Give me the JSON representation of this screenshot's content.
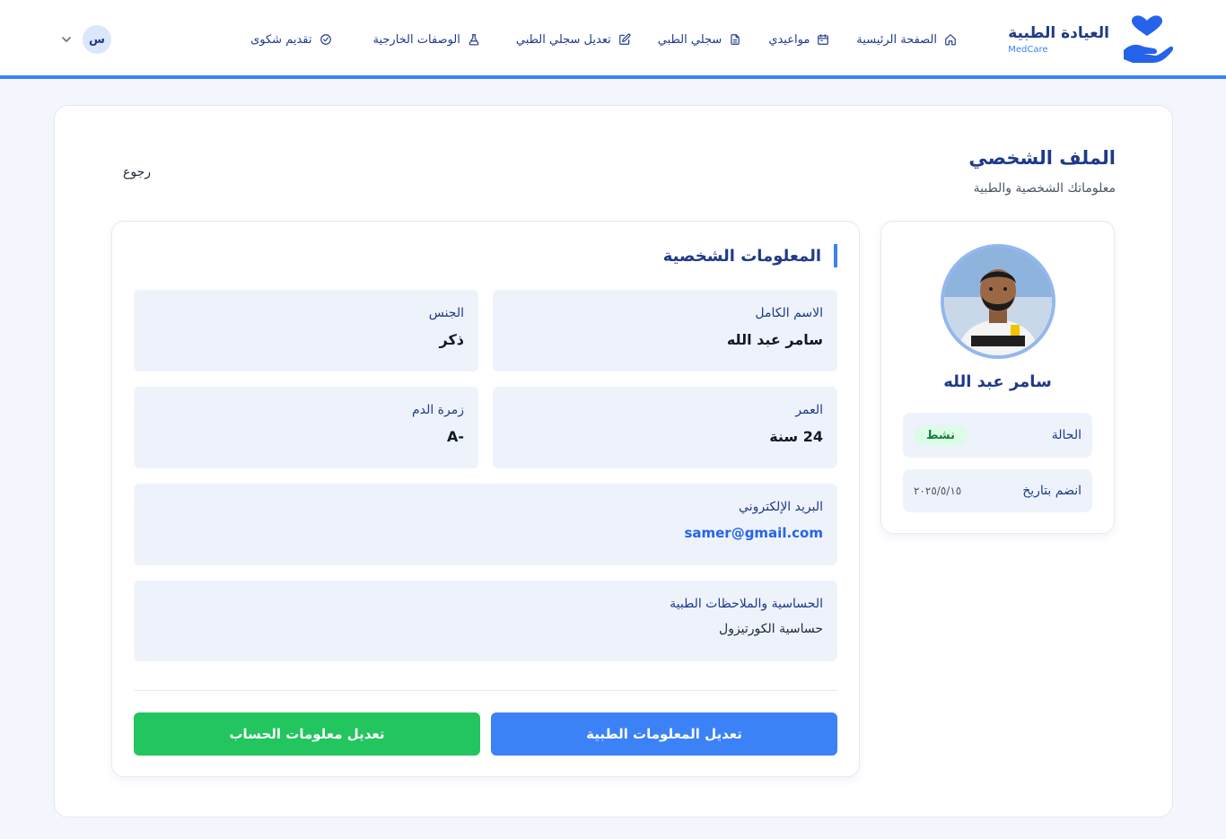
{
  "brand": {
    "title": "العيادة الطبية",
    "subtitle": "MedCare"
  },
  "nav": {
    "items": [
      {
        "label": "الصفحة الرئيسية",
        "icon": "home-icon"
      },
      {
        "label": "مواعيدي",
        "icon": "calendar-icon"
      },
      {
        "label": "سجلي الطبي",
        "icon": "document-icon"
      },
      {
        "label": "تعديل سجلي الطبي",
        "icon": "edit-icon"
      },
      {
        "label": "الوصفات الخارجية",
        "icon": "flask-icon"
      },
      {
        "label": "تقديم شكوى",
        "icon": "check-circle-icon"
      }
    ],
    "user_initial": "س"
  },
  "page": {
    "title": "الملف الشخصي",
    "subtitle": "معلوماتك الشخصية والطبية",
    "back_label": "رجوع"
  },
  "profile": {
    "name": "سامر عبد الله",
    "status_label": "الحالة",
    "status_value": "نشط",
    "joined_label": "انضم بتاريخ",
    "joined_value": "٢٠٢٥/٥/١٥"
  },
  "personal_info": {
    "section_title": "المعلومات الشخصية",
    "fields": {
      "full_name": {
        "label": "الاسم الكامل",
        "value": "سامر عبد الله"
      },
      "gender": {
        "label": "الجنس",
        "value": "ذكر"
      },
      "age": {
        "label": "العمر",
        "value": "24 سنة"
      },
      "blood_type": {
        "label": "زمرة الدم",
        "value": "-A"
      },
      "email": {
        "label": "البريد الإلكتروني",
        "value": "samer@gmail.com"
      },
      "notes": {
        "label": "الحساسية والملاحظات الطبية",
        "value": "حساسية الكورتيزول"
      }
    }
  },
  "actions": {
    "edit_medical": "تعديل المعلومات الطبية",
    "edit_account": "تعديل معلومات الحساب"
  },
  "colors": {
    "primary": "#3b82f6",
    "navy": "#1e3a8a",
    "success": "#22c55e",
    "badge_bg": "#dcfce7",
    "field_bg": "#eef3fb"
  }
}
